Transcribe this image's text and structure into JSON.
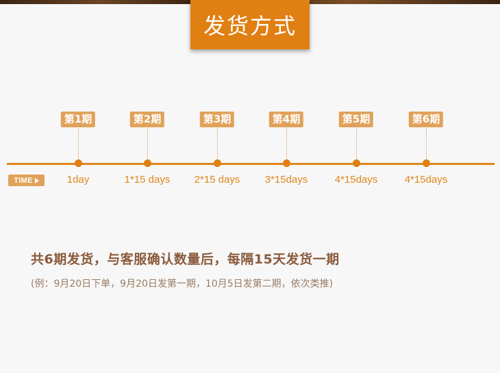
{
  "header": {
    "title": "发货方式"
  },
  "timeline": {
    "time_label": "TIME",
    "stages": [
      {
        "label": "第1期",
        "days": "1day"
      },
      {
        "label": "第2期",
        "days": "1*15 days"
      },
      {
        "label": "第3期",
        "days": "2*15 days"
      },
      {
        "label": "第4期",
        "days": "3*15days"
      },
      {
        "label": "第5期",
        "days": "4*15days"
      },
      {
        "label": "第6期",
        "days": "4*15days"
      }
    ]
  },
  "description": {
    "main": "共6期发货，与客服确认数量后，每隔15天发货一期",
    "note": "(例：9月20日下单，9月20日发第一期，10月5日发第二期，依次类推)"
  },
  "colors": {
    "accent": "#e07f12",
    "badge": "#e0a25a",
    "text_brown": "#8a5a3c",
    "background": "#f7f7f7"
  }
}
